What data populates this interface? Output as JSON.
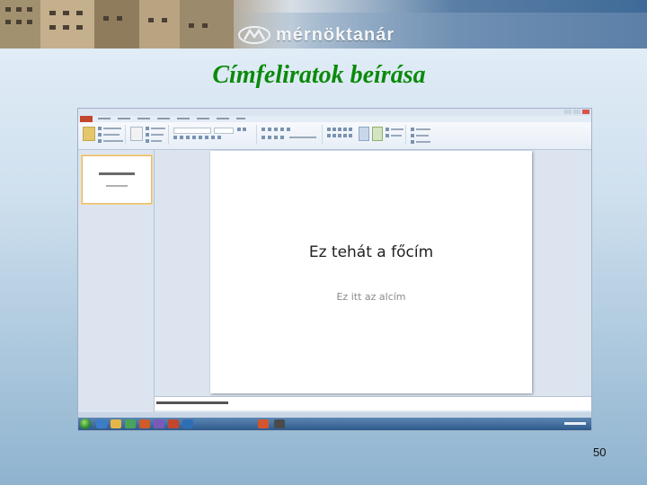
{
  "header": {
    "logo_text": "mérnöktanár"
  },
  "slide_title": "Címfeliratok beírása",
  "screenshot": {
    "slide": {
      "title_text": "Ez tehát a főcím",
      "subtitle_text": "Ez itt az alcím"
    }
  },
  "page_number": "50"
}
